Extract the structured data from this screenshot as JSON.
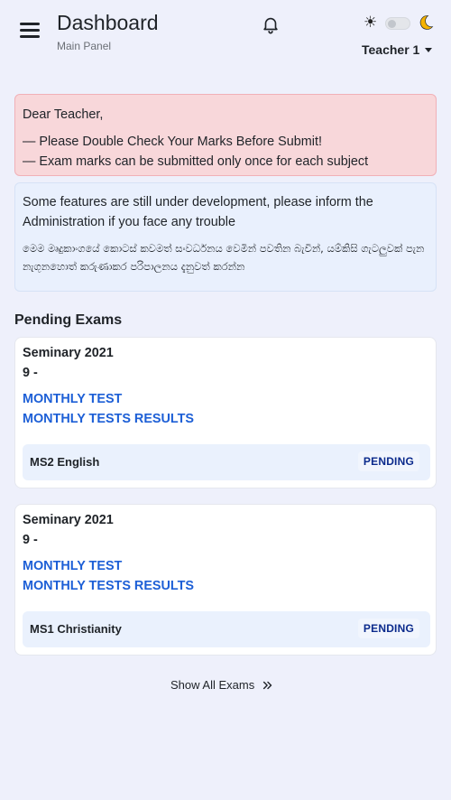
{
  "header": {
    "title": "Dashboard",
    "subtitle": "Main Panel",
    "user": "Teacher 1",
    "theme_icons": {
      "light": "sun-icon",
      "dark": "moon-icon"
    },
    "notification_icon": "bell-icon",
    "menu_icon": "hamburger-icon"
  },
  "alert_warning": {
    "greeting": "Dear Teacher,",
    "lines": [
      "— Please Double Check Your Marks Before Submit!",
      "— Exam marks can be submitted only once for each subject"
    ]
  },
  "alert_info": {
    "english": "Some features are still under development, please inform the Administration if you face any trouble",
    "sinhala": "මෙම මෘදුකාංගයේ කොටස් කවමත් සංවර්ධනය වෙමින් පවතින බැවින්, යම්කිසි ගැටලුවක් පැන නැගුනහොත් කරුණාකර පරිපාලනය දැනුවත් කරන්න"
  },
  "pending": {
    "title": "Pending Exams",
    "exams": [
      {
        "course": "Seminary 2021",
        "grade": "9 -",
        "link_test": "MONTHLY TEST",
        "link_results": "MONTHLY TESTS RESULTS",
        "subject": "MS2 English",
        "status": "PENDING"
      },
      {
        "course": "Seminary 2021",
        "grade": "9 -",
        "link_test": "MONTHLY TEST",
        "link_results": "MONTHLY TESTS RESULTS",
        "subject": "MS1 Christianity",
        "status": "PENDING"
      }
    ],
    "show_all": "Show All Exams"
  },
  "colors": {
    "background": "#eef0fb",
    "alert_danger_bg": "#f8d7da",
    "alert_info_bg": "#e9f0fd",
    "link": "#1d5fd6",
    "badge_text": "#0b2a8c",
    "moon": "#f5b301"
  }
}
